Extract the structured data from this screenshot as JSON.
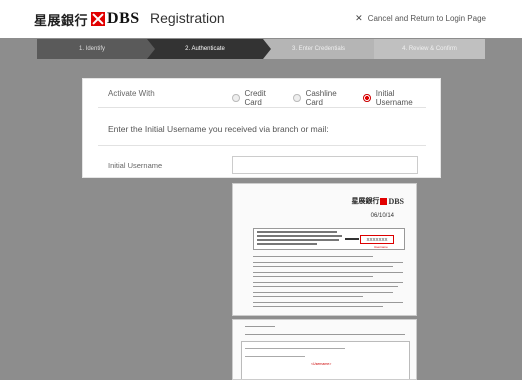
{
  "header": {
    "logo_cn": "星展銀行",
    "logo_en": "DBS",
    "title": "Registration",
    "cancel_label": "Cancel and Return to Login Page",
    "cancel_icon": "close-icon"
  },
  "stepper": {
    "steps": [
      {
        "label": "1. Identify"
      },
      {
        "label": "2. Authenticate"
      },
      {
        "label": "3. Enter Credentials"
      },
      {
        "label": "4. Review & Confirm"
      }
    ],
    "active_index": 1
  },
  "form": {
    "activate_label": "Activate With",
    "options": [
      {
        "label": "Credit Card",
        "selected": false
      },
      {
        "label": "Cashline Card",
        "selected": false
      },
      {
        "label": "Initial Username",
        "selected": true
      }
    ],
    "instruction": "Enter the Initial Username you received via branch or mail:",
    "field_label": "Initial Username",
    "field_value": ""
  },
  "letter": {
    "logo_cn": "星展銀行",
    "logo_en": "DBS",
    "date": "06/10/14",
    "username_sample": "XXXXXXX",
    "username_tag": "Username",
    "footer_hint": "<Username>"
  },
  "colors": {
    "accent": "#e10000",
    "stepper_active": "#333333",
    "backdrop": "#8d8d8d"
  }
}
